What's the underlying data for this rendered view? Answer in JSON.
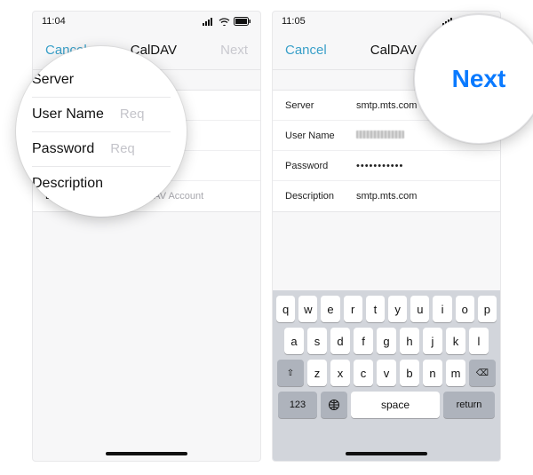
{
  "status": {
    "time_left": "11:04",
    "time_right": "11:05"
  },
  "nav": {
    "cancel": "Cancel",
    "title": "CalDAV",
    "next": "Next"
  },
  "form": {
    "labels": {
      "server": "Server",
      "username": "User Name",
      "password": "Password",
      "description": "Description"
    },
    "left": {
      "server": "",
      "username": "Required",
      "password": "Required",
      "description": "My CalDAV Account"
    },
    "right": {
      "server": "smtp.mts.com",
      "password": "•••••••••••",
      "description": "smtp.mts.com"
    }
  },
  "keyboard": {
    "row1": [
      "q",
      "w",
      "e",
      "r",
      "t",
      "y",
      "u",
      "i",
      "o",
      "p"
    ],
    "row2": [
      "a",
      "s",
      "d",
      "f",
      "g",
      "h",
      "j",
      "k",
      "l"
    ],
    "row3": [
      "z",
      "x",
      "c",
      "v",
      "b",
      "n",
      "m"
    ],
    "shift": "⇧",
    "del": "⌫",
    "n123": "123",
    "space": "space",
    "ret": "return"
  },
  "lens": {
    "left": {
      "server": "Server",
      "username": "User Name",
      "required": "Req",
      "password": "Password",
      "description": "Description"
    },
    "right": {
      "next": "Next"
    }
  }
}
